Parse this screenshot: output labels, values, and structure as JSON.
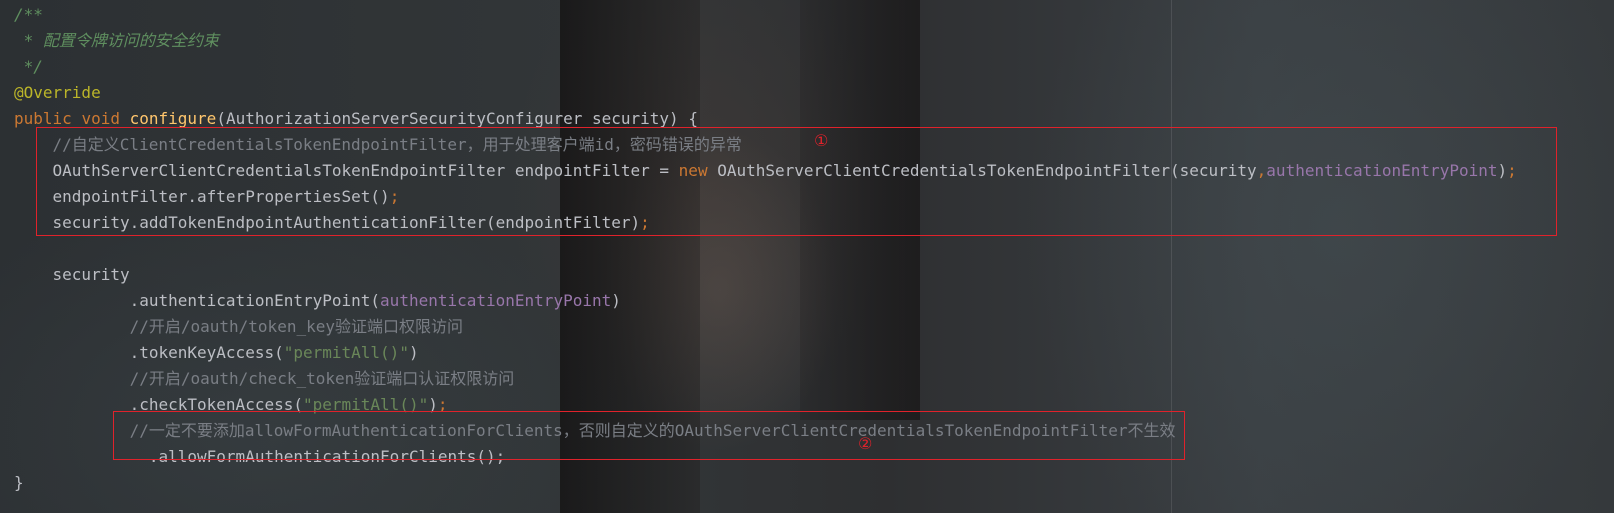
{
  "lines": [
    {
      "parts": [
        {
          "t": "/**",
          "c": "cmi"
        }
      ]
    },
    {
      "parts": [
        {
          "t": " * 配置令牌访问的安全约束",
          "c": "cmi"
        }
      ]
    },
    {
      "parts": [
        {
          "t": " */",
          "c": "cmi"
        }
      ]
    },
    {
      "parts": [
        {
          "t": "@Override",
          "c": "ann"
        }
      ]
    },
    {
      "parts": [
        {
          "t": "public",
          "c": "kw"
        },
        {
          "t": " "
        },
        {
          "t": "void",
          "c": "kw"
        },
        {
          "t": " "
        },
        {
          "t": "configure",
          "c": "fn"
        },
        {
          "t": "(AuthorizationServerSecurityConfigurer security) {"
        }
      ]
    },
    {
      "parts": [
        {
          "t": "    //自定义ClientCredentialsTokenEndpointFilter，用于处理客户端id，密码错误的异常",
          "c": "cm"
        }
      ]
    },
    {
      "parts": [
        {
          "t": "    OAuthServerClientCredentialsTokenEndpointFilter endpointFilter = "
        },
        {
          "t": "new",
          "c": "kw"
        },
        {
          "t": " OAuthServerClientCredentialsTokenEndpointFilter(security"
        },
        {
          "t": ",",
          "c": "kw"
        },
        {
          "t": "authenticationEntryPoint",
          "c": "fld"
        },
        {
          "t": ")"
        },
        {
          "t": ";",
          "c": "kw"
        }
      ]
    },
    {
      "parts": [
        {
          "t": "    endpointFilter.afterPropertiesSet()"
        },
        {
          "t": ";",
          "c": "kw"
        }
      ]
    },
    {
      "parts": [
        {
          "t": "    security.addTokenEndpointAuthenticationFilter(endpointFilter)"
        },
        {
          "t": ";",
          "c": "kw"
        }
      ]
    },
    {
      "parts": [
        {
          "t": ""
        }
      ]
    },
    {
      "parts": [
        {
          "t": "    security"
        }
      ]
    },
    {
      "parts": [
        {
          "t": "            .authenticationEntryPoint("
        },
        {
          "t": "authenticationEntryPoint",
          "c": "fld"
        },
        {
          "t": ")"
        }
      ]
    },
    {
      "parts": [
        {
          "t": "            //开启/oauth/token_key验证端口权限访问",
          "c": "cm"
        }
      ]
    },
    {
      "parts": [
        {
          "t": "            .tokenKeyAccess("
        },
        {
          "t": "\"permitAll()\"",
          "c": "str"
        },
        {
          "t": ")"
        }
      ]
    },
    {
      "parts": [
        {
          "t": "            //开启/oauth/check_token验证端口认证权限访问",
          "c": "cm"
        }
      ]
    },
    {
      "parts": [
        {
          "t": "            .checkTokenAccess("
        },
        {
          "t": "\"permitAll()\"",
          "c": "str"
        },
        {
          "t": ")"
        },
        {
          "t": ";",
          "c": "kw"
        }
      ]
    },
    {
      "parts": [
        {
          "t": "            //一定不要添加allowFormAuthenticationForClients，否则自定义的OAuthServerClientCredentialsTokenEndpointFilter不生效",
          "c": "cm"
        }
      ]
    },
    {
      "parts": [
        {
          "t": "              .allowFormAuthenticationForClients();"
        }
      ]
    },
    {
      "parts": [
        {
          "t": "}"
        }
      ]
    }
  ],
  "markers": {
    "first": "①",
    "second": "②"
  },
  "colors": {
    "annotation_box": "#e0222b",
    "comment": "#7a7e85",
    "keyword": "#cc7832",
    "string": "#6a8759",
    "field": "#9876aa",
    "method": "#ffc66d"
  }
}
